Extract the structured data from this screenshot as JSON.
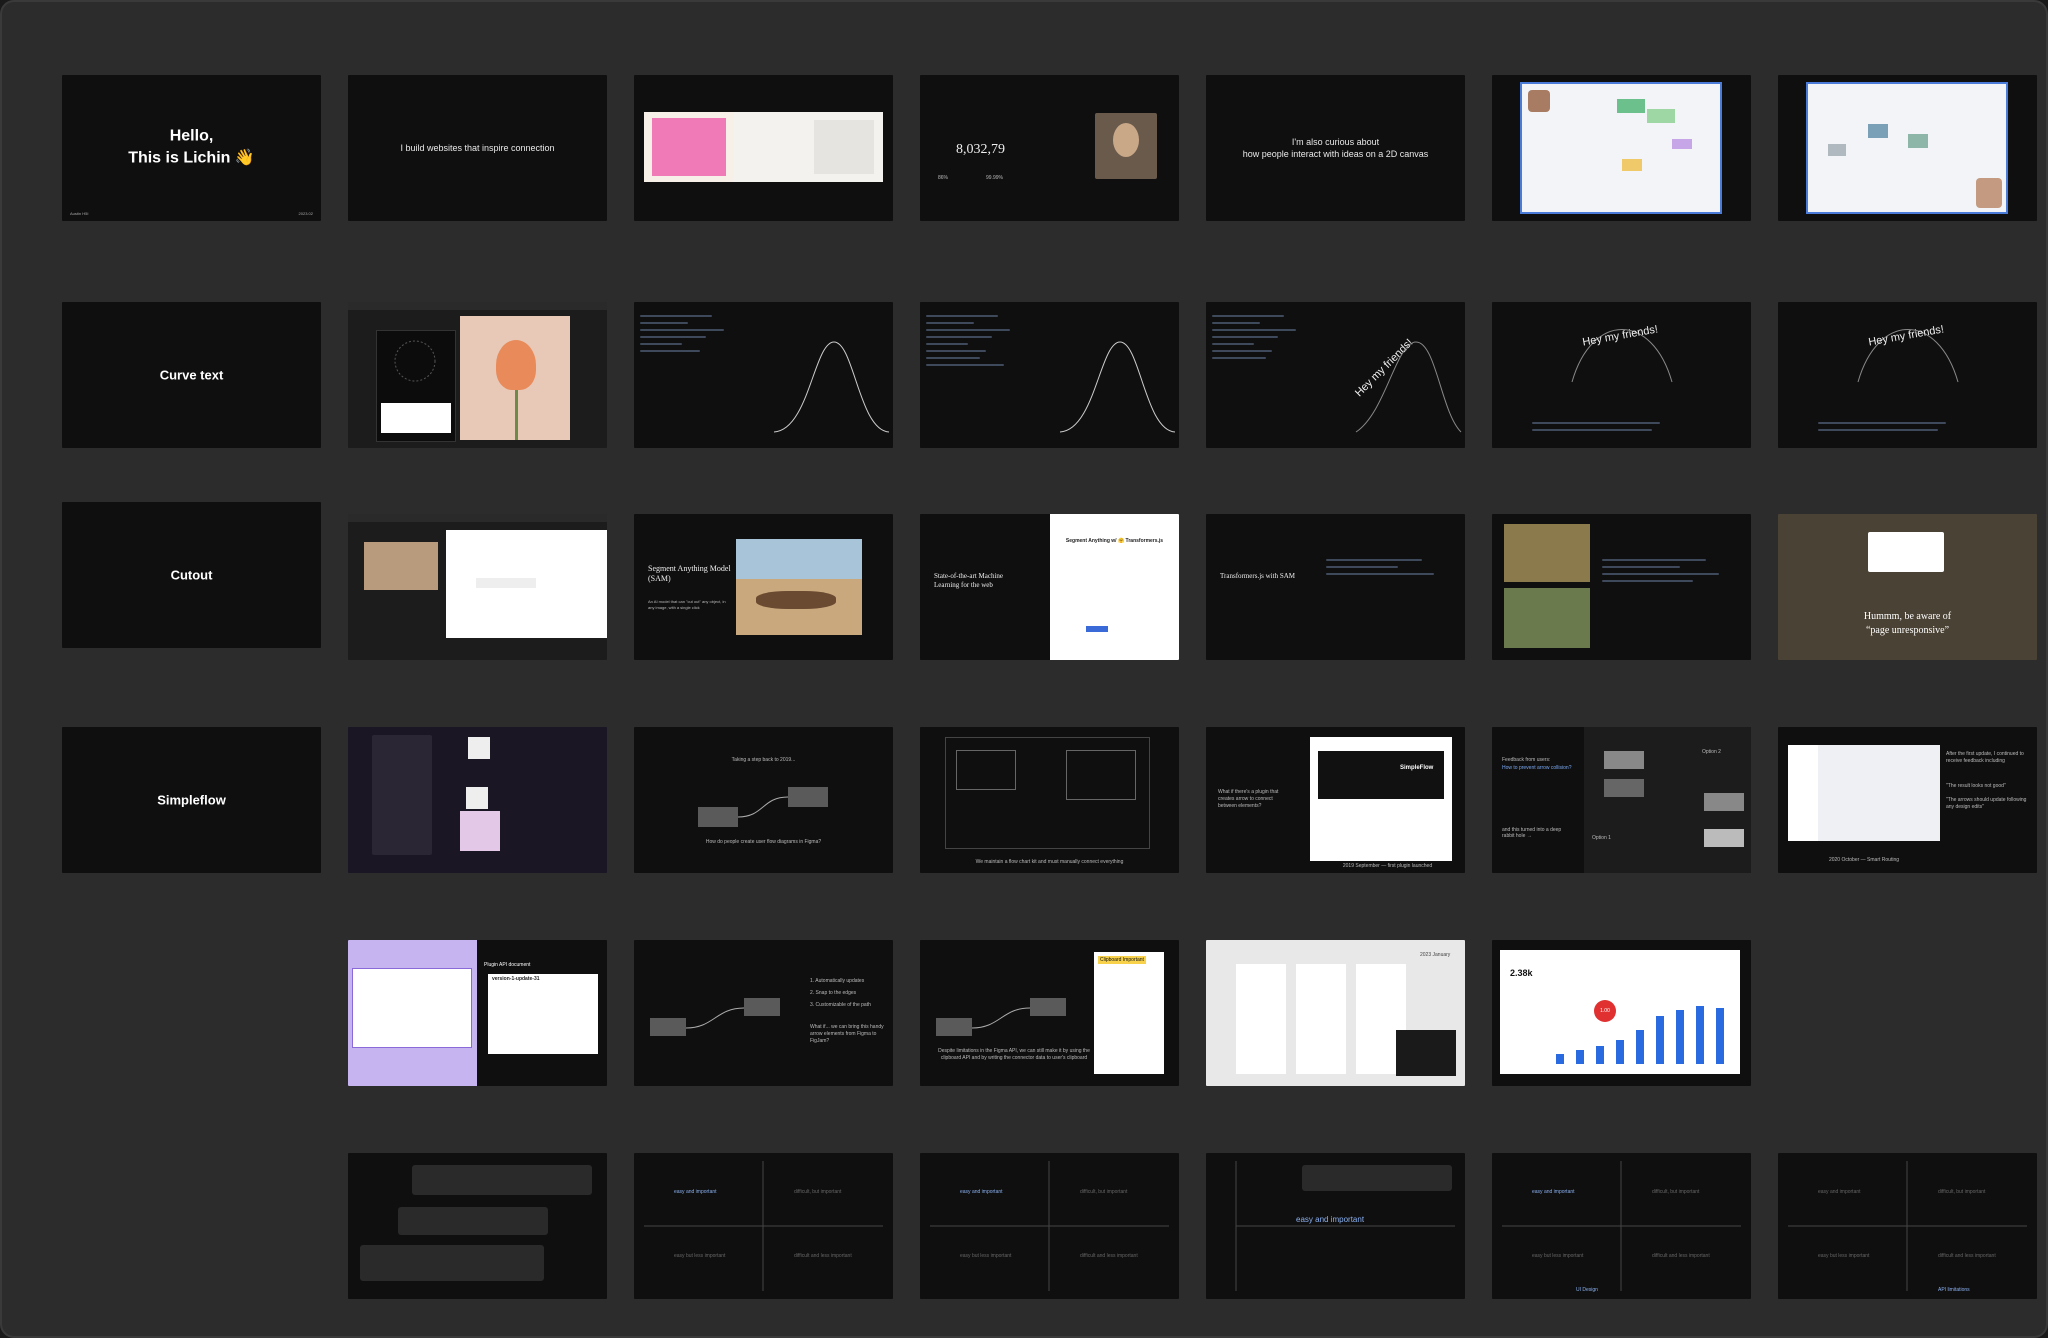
{
  "slides": {
    "hello": {
      "line1": "Hello,",
      "line2": "This is Lichin 👋",
      "footer_left": "Austin H5I",
      "footer_right": "2023.02"
    },
    "build": {
      "text": "I build websites that inspire connection"
    },
    "perf": {
      "number": "8,032,79",
      "pct1": "86%",
      "pct2": "99.99%"
    },
    "curious": {
      "line1": "I'm also curious about",
      "line2": "how people interact with ideas on a 2D canvas"
    },
    "curve_title": "Curve text",
    "hey_text": "Hey my friends!",
    "cutout_title": "Cutout",
    "sam": {
      "title": "Segment Anything Model (SAM)",
      "desc": "An AI model that can \"cut out\" any object, in any image, with a single click"
    },
    "sam_tf": {
      "title": "Segment Anything w/ 🤗 Transformers.js"
    },
    "sota": {
      "title": "State-of-the-art Machine Learning for the web"
    },
    "tfjs": {
      "title": "Transformers.js with SAM"
    },
    "unresponsive": {
      "line1": "Hummm, be aware of",
      "line2": "“page unresponsive”"
    },
    "simpleflow_title": "Simpleflow",
    "stepback": {
      "top": "Taking a step back to 2019...",
      "bottom": "How do people create user flow diagrams in Figma?"
    },
    "maintain": {
      "caption": "We maintain a flow chart kit and must manually connect everything"
    },
    "whatif": {
      "text": "What if there's a plugin that creates arrow to connect between elements?",
      "brand": "SimpleFlow",
      "caption": "2019 September — first plugin launched"
    },
    "feedback": {
      "line1": "Feedback from users:",
      "line2": "How to prevent arrow collision?",
      "line3": "and this turned into a deep rabbit hole →",
      "opt2": "Option 2",
      "opt1": "Option 1"
    },
    "october": {
      "caption": "2020 October — Smart Routing",
      "note1": "After the first update, I continued to receive feedback including",
      "note2": "\"The result looks not good\"",
      "note3": "\"The arrows should update following any design edits\""
    },
    "plugin_api": {
      "title": "Plugin API document",
      "version": "version-1-update-31"
    },
    "autoupdate": {
      "item1": "1. Automatically updates",
      "item2": "2. Snap to the edges",
      "item3": "3. Customizable of the path",
      "whatif": "What if... we can bring this handy arrow elements from Figma to FigJam?"
    },
    "limitations": {
      "text": "Despite limitations in the Figma API, we can still make it by using the clipboard API and by writing the connector data to user's clipboard",
      "badge": "Clipboard Important"
    },
    "january": {
      "label": "2023 January"
    },
    "stats": {
      "value": "2.38k",
      "badge": "1.00"
    },
    "matrix": {
      "easy_important": "easy and important",
      "difficult_important": "difficult, but important",
      "easy_less": "easy but less important",
      "difficult_less": "difficult and less important",
      "ui_design": "UI Design",
      "api_limitations": "API limitations"
    }
  }
}
